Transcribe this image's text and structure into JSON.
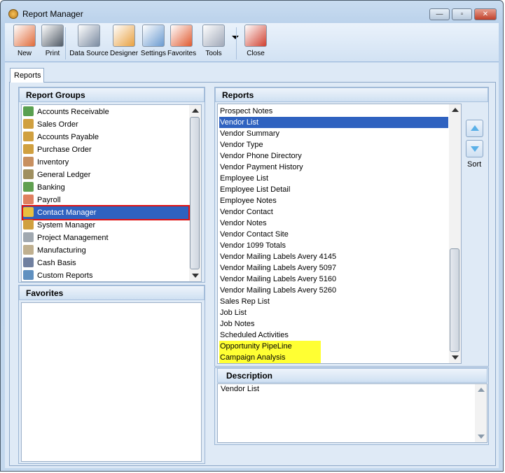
{
  "window": {
    "title": "Report Manager",
    "minimize": "—",
    "maximize": "▫",
    "close": "✕"
  },
  "toolbar": [
    {
      "label": "New",
      "icon": "new-report-icon",
      "color": "#e06b3a"
    },
    {
      "label": "Print",
      "icon": "printer-icon",
      "color": "#505a66"
    },
    {
      "label": "Data Source",
      "icon": "database-icon",
      "color": "#7a8aa0"
    },
    {
      "label": "Designer",
      "icon": "designer-icon",
      "color": "#e8a040"
    },
    {
      "label": "Settings",
      "icon": "settings-icon",
      "color": "#6a9ad0"
    },
    {
      "label": "Favorites",
      "icon": "favorites-icon",
      "color": "#e05a30"
    },
    {
      "label": "Tools",
      "icon": "tools-icon",
      "color": "#a0a8b8"
    },
    {
      "label": "Close",
      "icon": "close-report-icon",
      "color": "#d04030"
    }
  ],
  "tab": "Reports",
  "report_groups": {
    "title": "Report Groups",
    "selected": "Contact Manager",
    "items": [
      {
        "label": "Accounts Receivable",
        "color": "#5aa050"
      },
      {
        "label": "Sales Order",
        "color": "#d0a040"
      },
      {
        "label": "Accounts Payable",
        "color": "#d0a040"
      },
      {
        "label": "Purchase Order",
        "color": "#d0a040"
      },
      {
        "label": "Inventory",
        "color": "#c89060"
      },
      {
        "label": "General Ledger",
        "color": "#a09060"
      },
      {
        "label": "Banking",
        "color": "#60a050"
      },
      {
        "label": "Payroll",
        "color": "#e08060"
      },
      {
        "label": "Contact Manager",
        "color": "#e8c040"
      },
      {
        "label": "System Manager",
        "color": "#d0a040"
      },
      {
        "label": "Project Management",
        "color": "#a0a8b0"
      },
      {
        "label": "Manufacturing",
        "color": "#c0b090"
      },
      {
        "label": "Cash Basis",
        "color": "#7080a0"
      },
      {
        "label": "Custom Reports",
        "color": "#6090c0"
      }
    ]
  },
  "favorites": {
    "title": "Favorites",
    "items": []
  },
  "reports": {
    "title": "Reports",
    "selected": "Vendor List",
    "highlight_color": "#ffff33",
    "items": [
      {
        "label": "Prospect Notes"
      },
      {
        "label": "Vendor List"
      },
      {
        "label": "Vendor Summary"
      },
      {
        "label": "Vendor Type"
      },
      {
        "label": "Vendor Phone Directory"
      },
      {
        "label": "Vendor Payment History"
      },
      {
        "label": "Employee List"
      },
      {
        "label": "Employee List Detail"
      },
      {
        "label": "Employee Notes"
      },
      {
        "label": "Vendor Contact"
      },
      {
        "label": "Vendor Notes"
      },
      {
        "label": "Vendor Contact Site"
      },
      {
        "label": "Vendor 1099 Totals"
      },
      {
        "label": "Vendor Mailing Labels Avery 4145"
      },
      {
        "label": "Vendor Mailing Labels Avery 5097"
      },
      {
        "label": "Vendor Mailing Labels Avery 5160"
      },
      {
        "label": "Vendor Mailing Labels Avery 5260"
      },
      {
        "label": "Sales Rep List"
      },
      {
        "label": "Job List"
      },
      {
        "label": "Job Notes"
      },
      {
        "label": "Scheduled Activities"
      },
      {
        "label": "Opportunity PipeLine",
        "highlighted": true
      },
      {
        "label": "Campaign Analysis",
        "highlighted": true
      }
    ]
  },
  "sort": {
    "label": "Sort"
  },
  "description": {
    "title": "Description",
    "text": "Vendor List"
  }
}
